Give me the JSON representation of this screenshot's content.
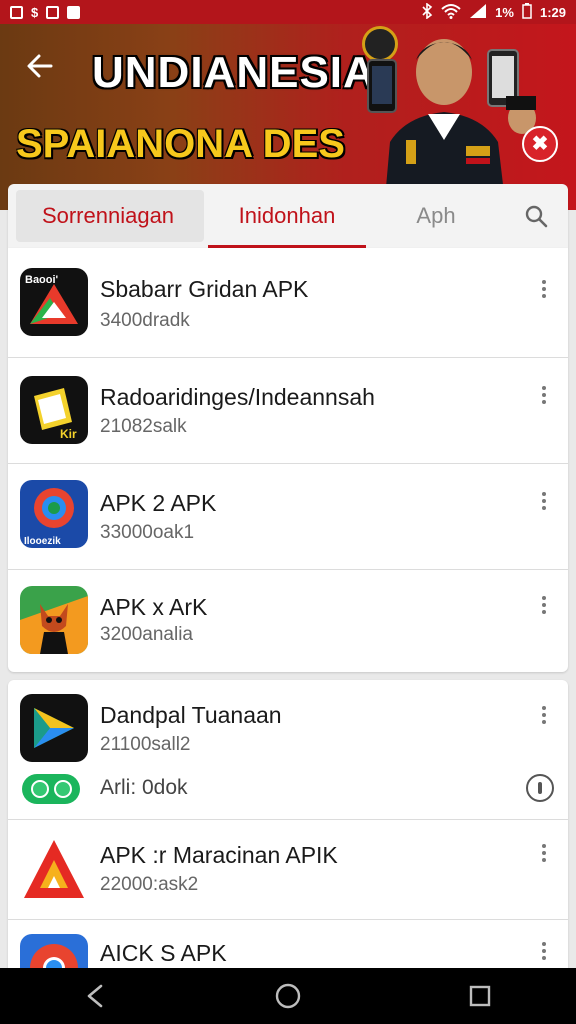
{
  "status_bar": {
    "left_icons": [
      "gallery-icon",
      "dollar-icon",
      "tag-icon",
      "sim-icon"
    ],
    "battery": "1%",
    "time": "1:29",
    "right_icons": [
      "bluetooth-icon",
      "wifi-icon",
      "signal-icon"
    ]
  },
  "header": {
    "title": "UNDIANESIA",
    "subtitle": "SPAIANONA DES"
  },
  "tabs": [
    {
      "label": "Sorrenniagan",
      "selected": false
    },
    {
      "label": "Inidonhan",
      "selected": true
    },
    {
      "label": "Aph",
      "selected": false
    }
  ],
  "apps": [
    {
      "name": "Sbabarr Gridan APK",
      "meta": "3400dradk",
      "icon": "play-triangle-icon"
    },
    {
      "name": "Radoaridinges/Indeannsah",
      "meta": "21082salk",
      "icon": "package-box-icon"
    },
    {
      "name": "APK 2 APK",
      "meta": "33000oak1",
      "icon": "browser-globe-icon"
    },
    {
      "name": "APK x ArK",
      "meta": "3200analia",
      "icon": "fox-mascot-icon"
    },
    {
      "name": "Dandpal Tuanaan",
      "meta": "21100sall2",
      "icon": "play-store-icon",
      "sub_label": "Arli: 0dok"
    },
    {
      "name": "APK :r Maracinan APIK",
      "meta": "22000:ask2",
      "icon": "red-triangle-icon"
    },
    {
      "name": "AICK S APK",
      "meta": "",
      "icon": "chrome-icon"
    }
  ],
  "colors": {
    "brand_red": "#c0121a",
    "status_bar": "#b3151b",
    "banner_gold": "#f7c81c"
  }
}
